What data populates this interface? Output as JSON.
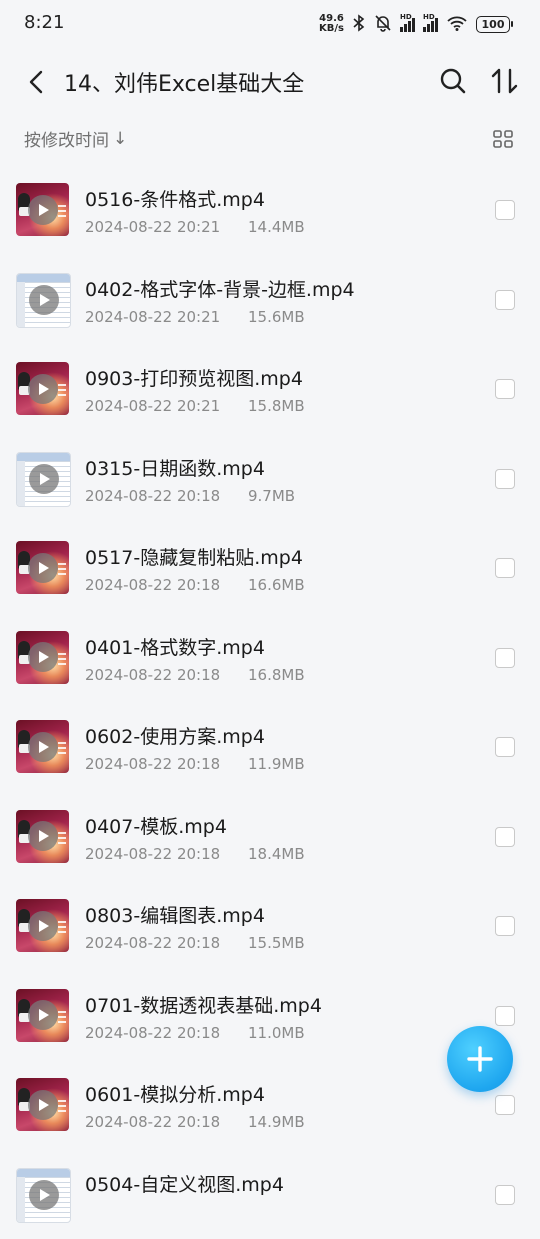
{
  "status_bar": {
    "time": "8:21",
    "net_speed_value": "49.6",
    "net_speed_unit": "KB/s",
    "battery": "100",
    "signal1_label": "HD",
    "signal2_label": "HD"
  },
  "header": {
    "title": "14、刘伟Excel基础大全",
    "back_icon": "chevron-left-icon",
    "search_icon": "search-icon",
    "sort_icon": "sort-icon"
  },
  "sort_bar": {
    "label": "按修改时间",
    "arrow": "↓",
    "view_toggle_icon": "grid-view-icon"
  },
  "files": [
    {
      "name": "0516-条件格式.mp4",
      "date": "2024-08-22 20:21",
      "size": "14.4MB",
      "thumb": "photo"
    },
    {
      "name": "0402-格式字体-背景-边框.mp4",
      "date": "2024-08-22 20:21",
      "size": "15.6MB",
      "thumb": "sheet"
    },
    {
      "name": "0903-打印预览视图.mp4",
      "date": "2024-08-22 20:21",
      "size": "15.8MB",
      "thumb": "photo"
    },
    {
      "name": "0315-日期函数.mp4",
      "date": "2024-08-22 20:18",
      "size": "9.7MB",
      "thumb": "sheet"
    },
    {
      "name": "0517-隐藏复制粘贴.mp4",
      "date": "2024-08-22 20:18",
      "size": "16.6MB",
      "thumb": "photo"
    },
    {
      "name": "0401-格式数字.mp4",
      "date": "2024-08-22 20:18",
      "size": "16.8MB",
      "thumb": "photo"
    },
    {
      "name": "0602-使用方案.mp4",
      "date": "2024-08-22 20:18",
      "size": "11.9MB",
      "thumb": "photo"
    },
    {
      "name": "0407-模板.mp4",
      "date": "2024-08-22 20:18",
      "size": "18.4MB",
      "thumb": "photo"
    },
    {
      "name": "0803-编辑图表.mp4",
      "date": "2024-08-22 20:18",
      "size": "15.5MB",
      "thumb": "photo"
    },
    {
      "name": "0701-数据透视表基础.mp4",
      "date": "2024-08-22 20:18",
      "size": "11.0MB",
      "thumb": "photo"
    },
    {
      "name": "0601-模拟分析.mp4",
      "date": "2024-08-22 20:18",
      "size": "14.9MB",
      "thumb": "photo"
    },
    {
      "name": "0504-自定义视图.mp4",
      "date": "",
      "size": "",
      "thumb": "sheet"
    }
  ],
  "fab": {
    "icon": "plus-icon",
    "color": "#1ea6ef"
  },
  "colors": {
    "background": "#f5f6f8",
    "primary_text": "#1b1b1b",
    "secondary_text": "#8a8a8a",
    "accent": "#1ea6ef"
  }
}
